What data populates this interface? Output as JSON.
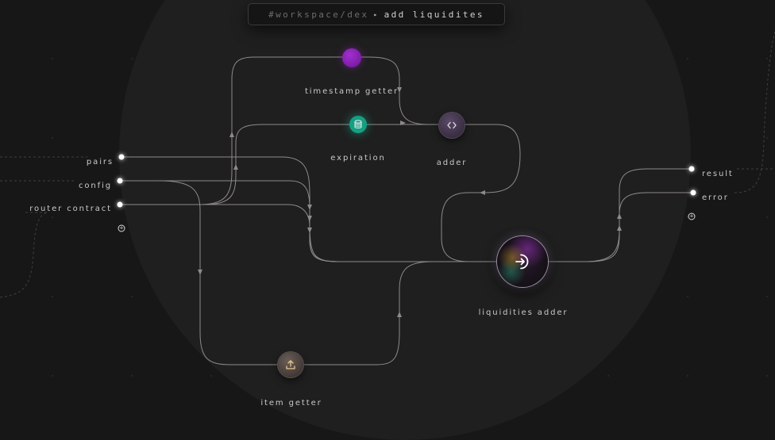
{
  "breadcrumb": {
    "path": "#workspace/dex",
    "separator": "▸",
    "current": "add liquidites"
  },
  "inputs": {
    "pairs": "pairs",
    "config": "config",
    "router_contract": "router contract",
    "add_port_icon": "plus-circle-icon"
  },
  "outputs": {
    "result": "result",
    "error": "error",
    "add_port_icon": "plus-circle-icon"
  },
  "nodes": {
    "timestamp_getter": {
      "label": "timestamp getter",
      "color": "#8e24c4"
    },
    "expiration": {
      "label": "expiration",
      "icon": "database-icon",
      "color": "#169f83"
    },
    "adder": {
      "label": "adder",
      "icon": "code-icon"
    },
    "liquidities_adder": {
      "label": "liquidities adder",
      "icon": "login-arrow-icon"
    },
    "item_getter": {
      "label": "item getter",
      "icon": "upload-icon"
    }
  },
  "colors": {
    "background": "#171717",
    "wire": "#8f8a8a",
    "port": "#ffffff"
  }
}
